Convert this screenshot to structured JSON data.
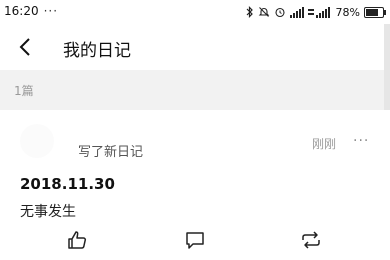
{
  "status_bar": {
    "time": "16:20",
    "dots": "···",
    "icons": [
      "bluetooth-icon",
      "mute-bell-icon",
      "alarm-icon",
      "signal-icon",
      "signal-icon"
    ],
    "battery_percent": "78%",
    "battery_level": 0.78
  },
  "nav": {
    "title": "我的日记",
    "back_icon": "chevron-left-icon"
  },
  "count": {
    "label": "1篇"
  },
  "post": {
    "action": "写了新日记",
    "time": "刚刚",
    "more": "···",
    "date": "2018.11.30",
    "body": "无事发生",
    "actions": [
      "thumbs-up-icon",
      "comment-icon",
      "repost-icon"
    ]
  },
  "colors": {
    "divider_bg": "#f2f2f2",
    "text_primary": "#111111",
    "text_secondary": "#9a9a9a"
  }
}
